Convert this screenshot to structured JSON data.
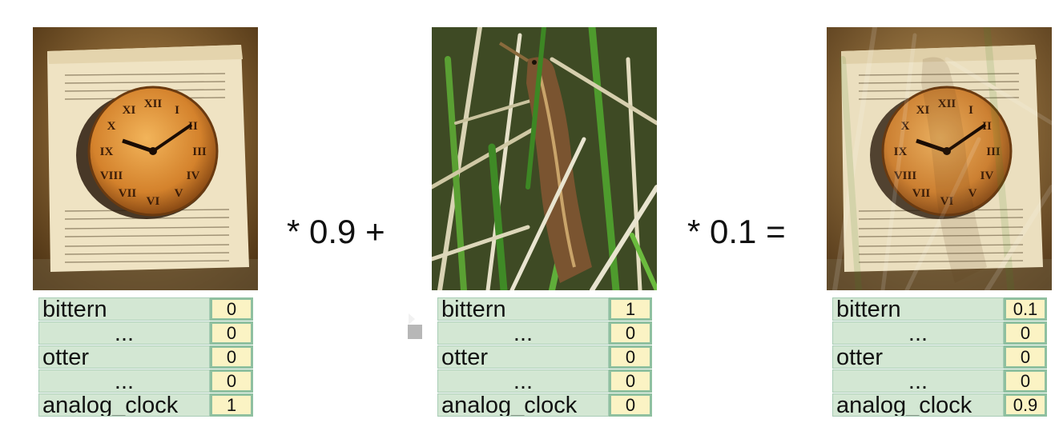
{
  "operators": {
    "first": "* 0.9 +",
    "second": "* 0.1 ="
  },
  "panels": [
    {
      "image": "clock-on-book-image",
      "rows": [
        {
          "label": "bittern",
          "value": "0"
        },
        {
          "label": "...",
          "value": "0"
        },
        {
          "label": "otter",
          "value": "0"
        },
        {
          "label": "...",
          "value": "0"
        },
        {
          "label": "analog_clock",
          "value": "1"
        }
      ]
    },
    {
      "image": "bittern-in-reeds-image",
      "rows": [
        {
          "label": "bittern",
          "value": "1"
        },
        {
          "label": "...",
          "value": "0"
        },
        {
          "label": "otter",
          "value": "0"
        },
        {
          "label": "...",
          "value": "0"
        },
        {
          "label": "analog_clock",
          "value": "0"
        }
      ]
    },
    {
      "image": "blended-clock-bittern-image",
      "rows": [
        {
          "label": "bittern",
          "value": "0.1"
        },
        {
          "label": "...",
          "value": "0"
        },
        {
          "label": "otter",
          "value": "0"
        },
        {
          "label": "...",
          "value": "0"
        },
        {
          "label": "analog_clock",
          "value": "0.9"
        }
      ]
    }
  ],
  "colors": {
    "label_bg": "#d3e7d3",
    "value_bg": "#fbf3c4",
    "value_border": "#8fc0a0"
  }
}
